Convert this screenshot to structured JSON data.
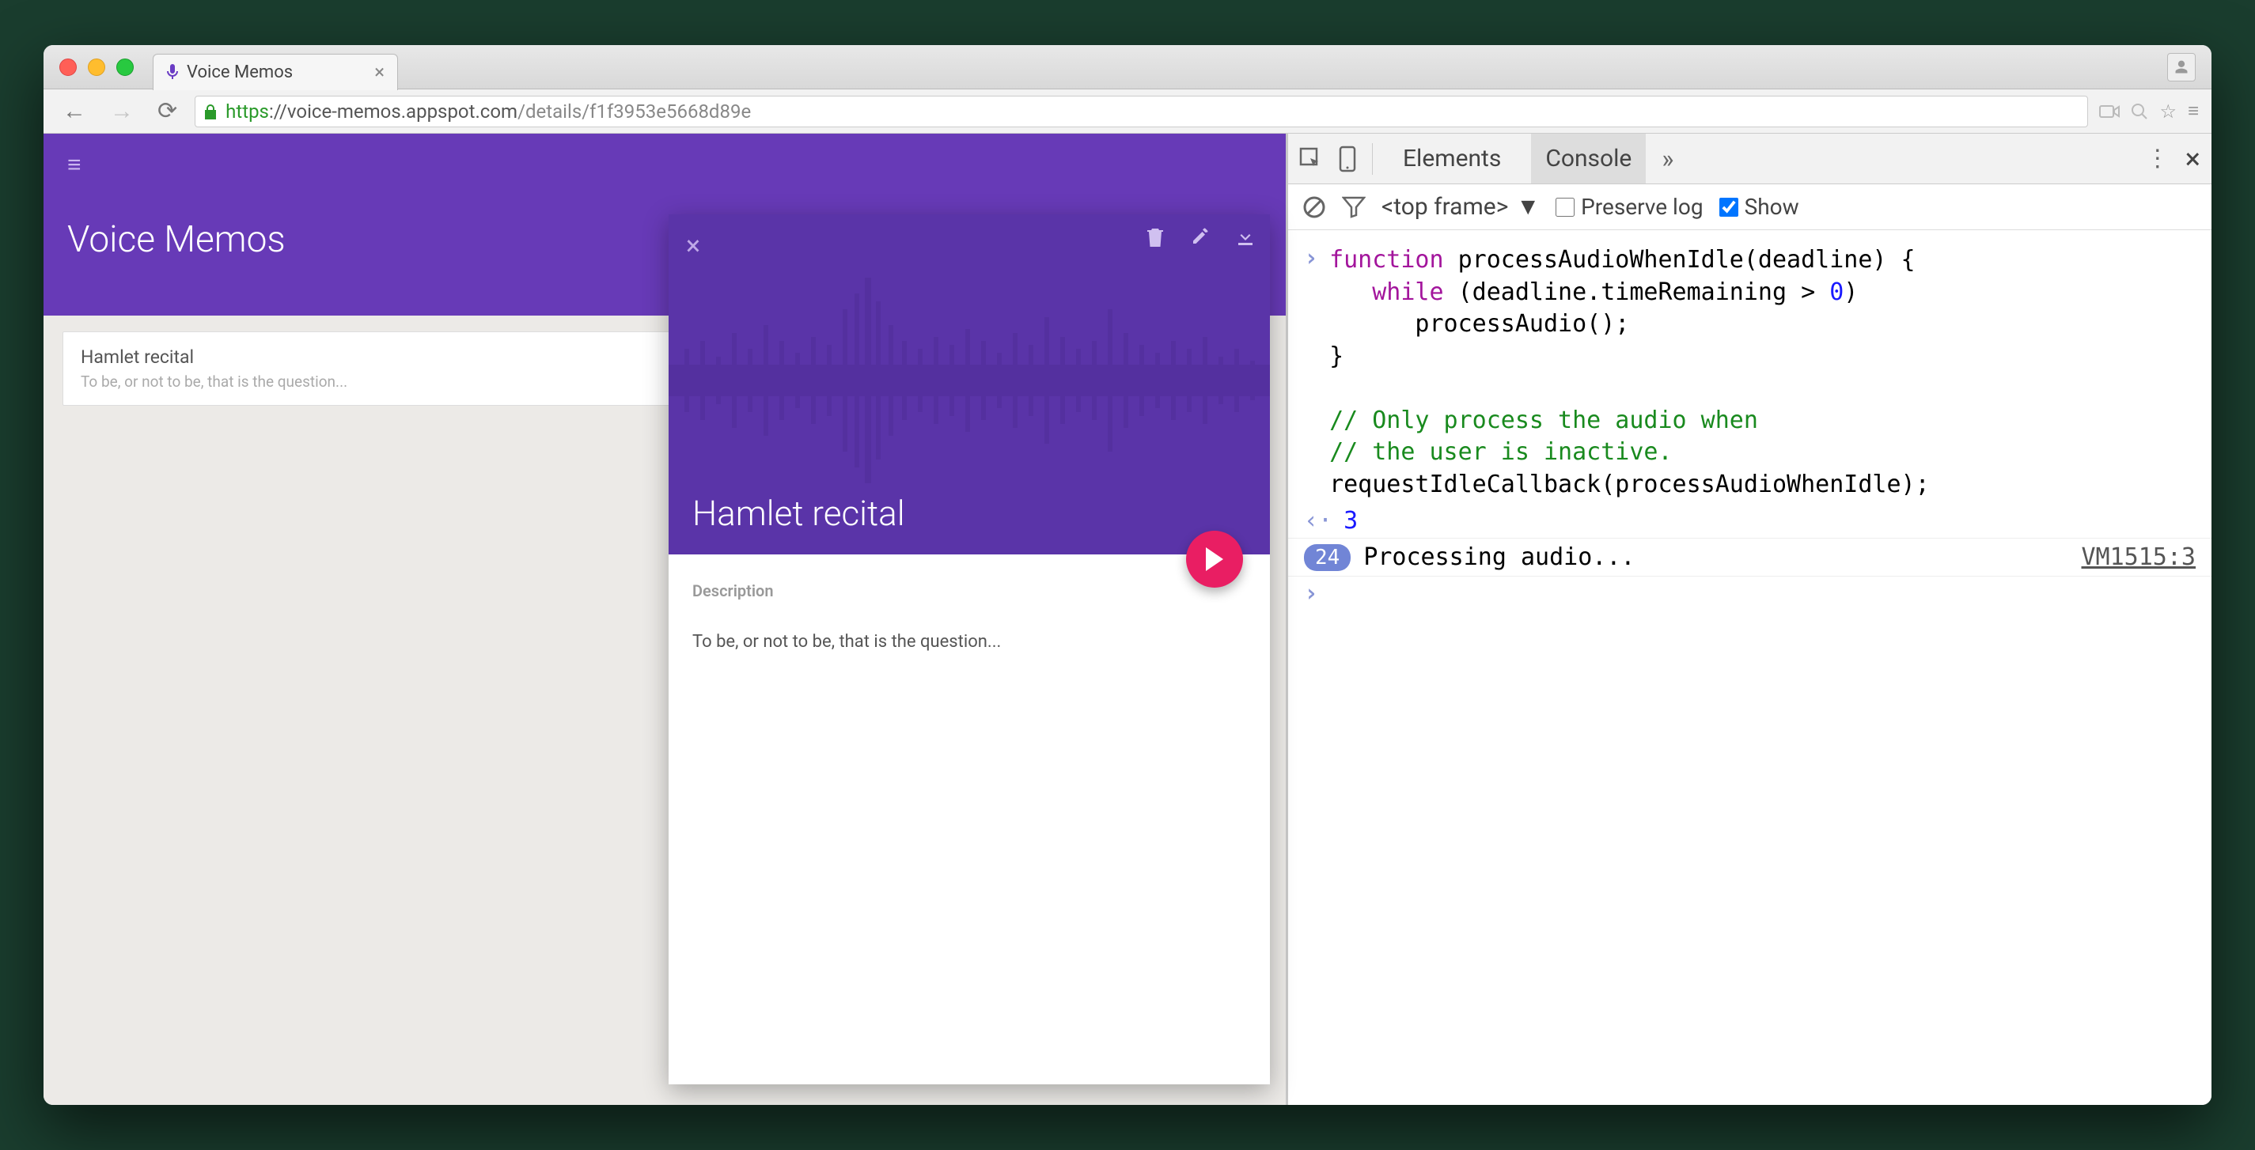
{
  "browser": {
    "tab": {
      "title": "Voice Memos"
    },
    "url": {
      "https_prefix": "https",
      "host": "://voice-memos.appspot.com",
      "path": "/details/f1f3953e5668d89e"
    }
  },
  "app": {
    "title": "Voice Memos",
    "list": [
      {
        "title": "Hamlet recital",
        "subtitle": "To be, or not to be, that is the question..."
      }
    ],
    "detail": {
      "title": "Hamlet recital",
      "desc_label": "Description",
      "desc_text": "To be, or not to be, that is the question..."
    }
  },
  "devtools": {
    "tabs": {
      "elements": "Elements",
      "console": "Console"
    },
    "toolbar": {
      "frame": "<top frame>",
      "preserve": "Preserve log",
      "show": "Show"
    },
    "code": {
      "l1a": "function",
      "l1b": " processAudioWhenIdle(deadline) {",
      "l2a": "while",
      "l2b": " (deadline.timeRemaining > ",
      "l2c": "0",
      "l2d": ")",
      "l3": "processAudio();",
      "l4": "}",
      "l5": "// Only process the audio when",
      "l6": "// the user is inactive.",
      "l7": "requestIdleCallback(processAudioWhenIdle);"
    },
    "return_val": "3",
    "log": {
      "count": "24",
      "msg": "Processing audio...",
      "link": "VM1515:3"
    }
  }
}
